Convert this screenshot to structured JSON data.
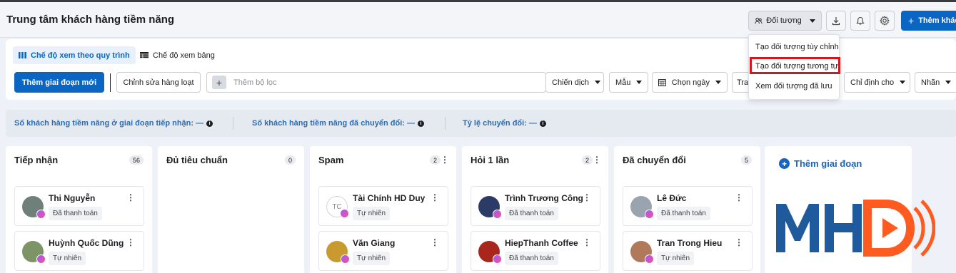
{
  "header": {
    "title": "Trung tâm khách hàng tiềm năng",
    "audience_label": "Đối tượng",
    "add_label": "Thêm khác"
  },
  "audience_menu": {
    "items": [
      "Tạo đối tượng tùy chỉnh",
      "Tạo đối tượng tương tự",
      "Xem đối tượng đã lưu"
    ]
  },
  "view_tabs": {
    "pipeline": "Chế độ xem theo quy trình",
    "table": "Chế độ xem bảng"
  },
  "toolbar": {
    "new_stage": "Thêm giai đoạn mới",
    "bulk_edit": "Chỉnh sửa hàng loạt",
    "filter_placeholder": "Thêm bộ lọc",
    "campaign": "Chiến dịch",
    "form": "Mẫu",
    "date": "Chọn ngày",
    "status_partial": "Tran",
    "assign": "Chỉ định cho",
    "label": "Nhãn"
  },
  "stats": {
    "intake": "Số khách hàng tiềm năng ở giai đoạn tiếp nhận: —",
    "converted": "Số khách hàng tiềm năng đã chuyển đổi: —",
    "rate": "Tỷ lệ chuyển đổi: —"
  },
  "columns": [
    {
      "title": "Tiếp nhận",
      "count": "56",
      "cards": [
        {
          "name": "Thi Nguyễn",
          "tag": "Đã thanh toán"
        },
        {
          "name": "Huỳnh Quốc Dũng",
          "tag": "Tự nhiên"
        }
      ]
    },
    {
      "title": "Đủ tiêu chuẩn",
      "count": "0",
      "cards": []
    },
    {
      "title": "Spam",
      "count": "2",
      "cards": [
        {
          "name": "Tài Chính HD Duy",
          "tag": "Tự nhiên",
          "initials": "TC"
        },
        {
          "name": "Văn Giang",
          "tag": "Tự nhiên"
        }
      ]
    },
    {
      "title": "Hỏi 1 lần",
      "count": "2",
      "cards": [
        {
          "name": "Trình Trương Công",
          "tag": "Đã thanh toán"
        },
        {
          "name": "HiepThanh Coffee",
          "tag": "Đã thanh toán"
        }
      ]
    },
    {
      "title": "Đã chuyển đổi",
      "count": "5",
      "cards": [
        {
          "name": "Lê Đức",
          "tag": "Đã thanh toán"
        },
        {
          "name": "Tran Trong Hieu",
          "tag": "Tự nhiên"
        }
      ]
    }
  ],
  "add_stage": "Thêm giai đoạn",
  "logo": "MHD",
  "colors": {
    "primary": "#0a66c2",
    "highlight": "#d8141c",
    "logo_blue": "#1e5a9c",
    "logo_orange": "#ff5a1f"
  },
  "icons": [
    "people-icon",
    "download-icon",
    "bell-icon",
    "gear-icon",
    "columns-icon",
    "table-icon",
    "calendar-icon",
    "info-icon",
    "messenger-icon",
    "plus-icon"
  ]
}
